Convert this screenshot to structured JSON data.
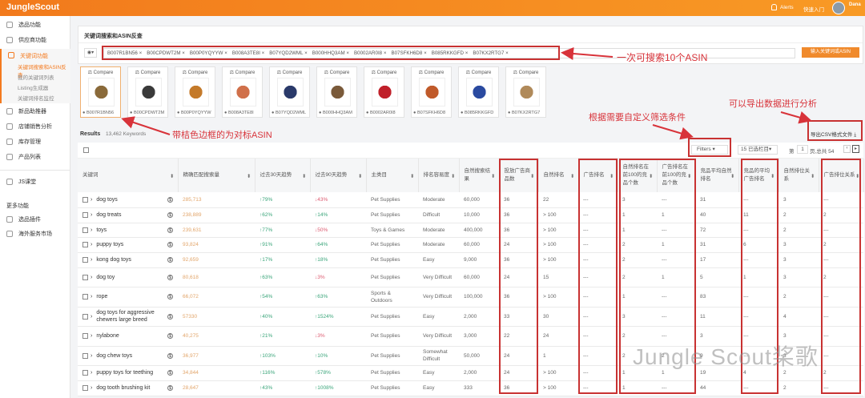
{
  "header": {
    "logo": "JungleScout",
    "alerts": "Alerts",
    "quick_start": "快速入门",
    "user": "Dana"
  },
  "sidebar": {
    "items": [
      {
        "label": "选品功能"
      },
      {
        "label": "供应商功能"
      },
      {
        "label": "关键词功能"
      },
      {
        "label": "新品助推器"
      },
      {
        "label": "店铺销售分析"
      },
      {
        "label": "库存管理"
      },
      {
        "label": "产品列表"
      },
      {
        "label": "JS课堂"
      }
    ],
    "sub_items": [
      {
        "label": "关键词搜索和ASIN反查"
      },
      {
        "label": "我的关键词列表"
      },
      {
        "label": "Listing生成器"
      },
      {
        "label": "关键词排名监控"
      }
    ],
    "more_title": "更多功能",
    "more_items": [
      {
        "label": "选品插件"
      },
      {
        "label": "海外服务市场"
      }
    ]
  },
  "search": {
    "title": "关键词搜索和ASIN反查",
    "asins": [
      "B007R1BN56",
      "B00CPDWT2M",
      "B00P0YQYYW",
      "B008A3TE8I",
      "B07YQD2WML",
      "B000HHQ3AM",
      "B0002AR0I8",
      "B07SFKH6D8",
      "B085RKKGFD",
      "B07KX2RTG7"
    ],
    "button": "输入关键词或ASIN"
  },
  "compare_label": "Compare",
  "results": {
    "label": "Results",
    "count": "13,462 Keywords"
  },
  "toolbar": {
    "filters": "Filters",
    "columns": "15 已选栏目",
    "page_prefix": "第",
    "page": "1",
    "page_suffix": "页,总共 54",
    "export": "导出CSV格式文件"
  },
  "annotations": {
    "asin_limit": "一次可搜索10个ASIN",
    "reference": "带桔色边框的为对标ASIN",
    "filters": "根据需要自定义筛选条件",
    "export": "可以导出数据进行分析"
  },
  "watermark": "Jungle Scout桨歌",
  "colors": {
    "accent": "#f47a1f",
    "annotation": "#c83232",
    "up": "#3aa57a",
    "down": "#dd5a70"
  },
  "table": {
    "headers": [
      "关键词",
      "精确匹配搜索量",
      "过去30天趋势",
      "过去90天趋势",
      "主类目",
      "排名容易度",
      "自然搜索结果",
      "投放广告商品数",
      "自然排名",
      "广告排名",
      "自然排名在前100的竞品个数",
      "广告排名在前100的竞品个数",
      "竞品平均自然排名",
      "竞品的平均广告排名",
      "自然排位关系",
      "广告排位关系"
    ],
    "rows": [
      [
        "dog toys",
        "285,713",
        "↑79%",
        "↓43%",
        "Pet Supplies",
        "Moderate",
        "60,000",
        "36",
        "22",
        "---",
        "3",
        "---",
        "31",
        "---",
        "3",
        "---"
      ],
      [
        "dog treats",
        "238,889",
        "↑62%",
        "↑14%",
        "Pet Supplies",
        "Difficult",
        "10,000",
        "36",
        "> 100",
        "---",
        "1",
        "1",
        "40",
        "11",
        "2",
        "2"
      ],
      [
        "toys",
        "239,631",
        "↑77%",
        "↓50%",
        "Toys & Games",
        "Moderate",
        "400,000",
        "36",
        "> 100",
        "---",
        "1",
        "---",
        "72",
        "---",
        "2",
        "---"
      ],
      [
        "puppy toys",
        "93,824",
        "↑91%",
        "↑64%",
        "Pet Supplies",
        "Moderate",
        "60,000",
        "24",
        "> 100",
        "---",
        "2",
        "1",
        "31",
        "6",
        "3",
        "2"
      ],
      [
        "kong dog toys",
        "92,659",
        "↑17%",
        "↑18%",
        "Pet Supplies",
        "Easy",
        "9,000",
        "36",
        "> 100",
        "---",
        "2",
        "---",
        "17",
        "---",
        "3",
        "---"
      ],
      [
        "dog toy",
        "80,618",
        "↑63%",
        "↓3%",
        "Pet Supplies",
        "Very Difficult",
        "60,000",
        "24",
        "15",
        "---",
        "2",
        "1",
        "5",
        "1",
        "3",
        "2"
      ],
      [
        "rope",
        "66,072",
        "↑54%",
        "↑63%",
        "Sports & Outdoors",
        "Very Difficult",
        "100,000",
        "36",
        "> 100",
        "---",
        "1",
        "---",
        "83",
        "---",
        "2",
        "---"
      ],
      [
        "dog toys for aggressive chewers large breed",
        "57330",
        "↑40%",
        "↑1524%",
        "Pet Supplies",
        "Easy",
        "2,000",
        "33",
        "30",
        "---",
        "3",
        "---",
        "11",
        "---",
        "4",
        "---"
      ],
      [
        "nylabone",
        "40,275",
        "↑21%",
        "↓3%",
        "Pet Supplies",
        "Very Difficult",
        "3,000",
        "22",
        "24",
        "---",
        "2",
        "---",
        "3",
        "---",
        "3",
        "---"
      ],
      [
        "dog chew toys",
        "36,977",
        "↑103%",
        "↑10%",
        "Pet Supplies",
        "Somewhat Difficult",
        "50,000",
        "24",
        "1",
        "---",
        "2",
        "2",
        "9",
        "---",
        "3",
        "---"
      ],
      [
        "puppy toys for teething",
        "34,844",
        "↑116%",
        "↑578%",
        "Pet Supplies",
        "Easy",
        "2,000",
        "24",
        "> 100",
        "---",
        "1",
        "1",
        "19",
        "4",
        "2",
        "2"
      ],
      [
        "dog tooth brushing kit",
        "28,647",
        "↑43%",
        "↑1008%",
        "Pet Supplies",
        "Easy",
        "333",
        "36",
        "> 100",
        "---",
        "1",
        "---",
        "44",
        "---",
        "2",
        "---"
      ]
    ]
  }
}
